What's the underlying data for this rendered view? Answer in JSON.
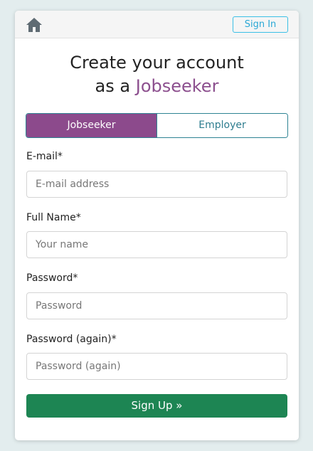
{
  "header": {
    "home_icon": "home-icon",
    "signin_label": "Sign In"
  },
  "title": {
    "line1": "Create your account",
    "line2_prefix": "as a ",
    "line2_accent": "Jobseeker"
  },
  "role_toggle": {
    "options": [
      {
        "label": "Jobseeker",
        "active": true
      },
      {
        "label": "Employer",
        "active": false
      }
    ]
  },
  "form": {
    "email": {
      "label": "E-mail*",
      "placeholder": "E-mail address",
      "value": ""
    },
    "full_name": {
      "label": "Full Name*",
      "placeholder": "Your name",
      "value": ""
    },
    "password": {
      "label": "Password*",
      "placeholder": "Password",
      "value": ""
    },
    "password_again": {
      "label": "Password (again)*",
      "placeholder": "Password (again)",
      "value": ""
    },
    "submit_label": "Sign Up »"
  },
  "colors": {
    "accent_purple": "#8c4a8c",
    "submit_green": "#1d8553",
    "signin_blue": "#2aa8d6",
    "toggle_border": "#2e8393"
  }
}
